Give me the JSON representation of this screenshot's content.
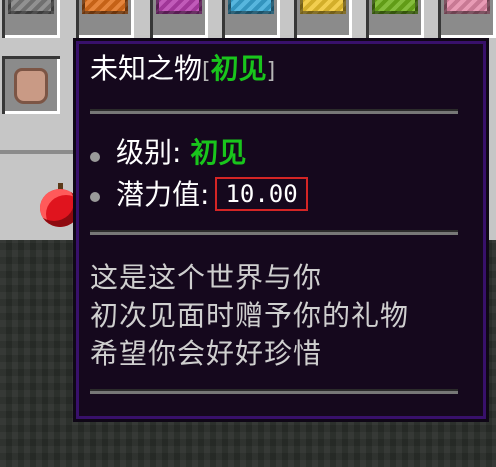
{
  "tooltip": {
    "title": "未知之物",
    "title_tag_open": "[",
    "title_tag": "初见",
    "title_tag_close": "]",
    "level_label": "级别: ",
    "level_value": "初见",
    "potential_label": "潜力值:",
    "potential_value": "10.00",
    "description": [
      "这是这个世界与你",
      "初次见面时赠予你的礼物",
      "希望你会好好珍惜"
    ]
  },
  "inventory": {
    "top_row_items": [
      {
        "icon": "gray-wool-icon",
        "color": "#7e7e7e"
      },
      {
        "icon": "orange-wool-icon",
        "color": "#e0701a"
      },
      {
        "icon": "magenta-wool-icon",
        "color": "#b63dad"
      },
      {
        "icon": "light-blue-wool-icon",
        "color": "#3aa9d8"
      },
      {
        "icon": "yellow-wool-icon",
        "color": "#f0c630"
      },
      {
        "icon": "lime-wool-icon",
        "color": "#6eb21a"
      },
      {
        "icon": "pink-wool-icon",
        "color": "#e48aa8"
      }
    ],
    "side_items": [
      "leather-icon",
      "apple-icon"
    ]
  },
  "colors": {
    "tag_green": "#19c51c",
    "tooltip_bg": "#15081d",
    "tooltip_border": "#38106b",
    "highlight_box": "#d42525"
  }
}
